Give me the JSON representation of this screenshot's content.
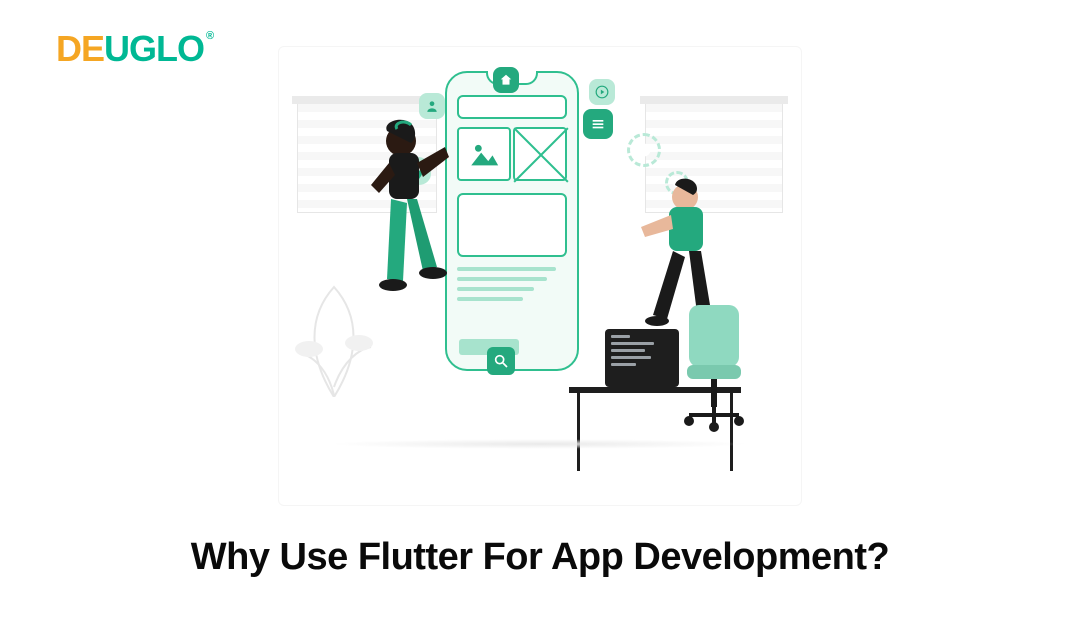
{
  "brand": {
    "name_part1": "DE",
    "name_part2": "UGLO",
    "registered": "®"
  },
  "title": "Why Use Flutter For App Development?",
  "colors": {
    "accent": "#24a97e",
    "accent_light": "#b9e9d7",
    "brand_orange": "#f5a623",
    "brand_green": "#00b894",
    "text": "#0a0a0a"
  },
  "icons": {
    "user": "user",
    "home": "home",
    "play": "play",
    "menu": "menu",
    "pin": "pin",
    "search": "search",
    "gear": "gear",
    "image": "image"
  }
}
